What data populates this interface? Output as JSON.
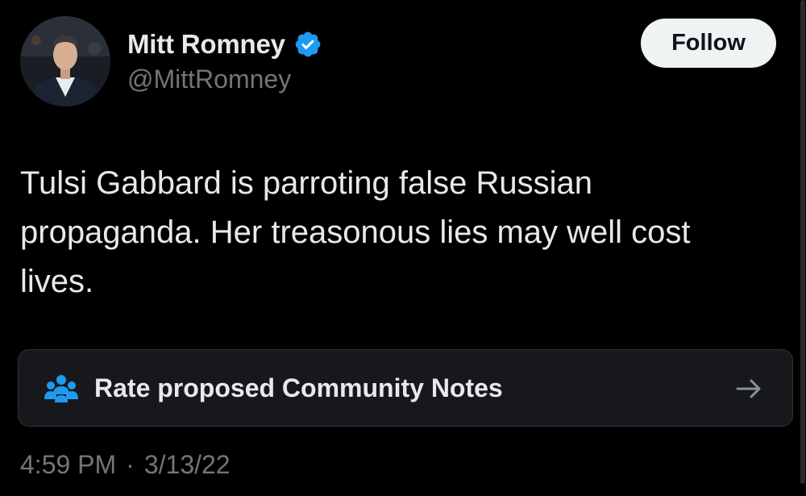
{
  "author": {
    "display_name": "Mitt Romney",
    "handle": "@MittRomney",
    "verified": true,
    "verified_color": "#1d9bf0"
  },
  "follow_button": {
    "label": "Follow"
  },
  "tweet": {
    "text": "Tulsi Gabbard is parroting false Russian propaganda. Her treasonous lies may well cost lives."
  },
  "community_notes": {
    "label": "Rate proposed Community Notes",
    "icon": "people-icon",
    "icon_color": "#1d9bf0",
    "arrow_icon": "arrow-right-icon"
  },
  "meta": {
    "time": "4:59 PM",
    "separator": "·",
    "date": "3/13/22"
  }
}
